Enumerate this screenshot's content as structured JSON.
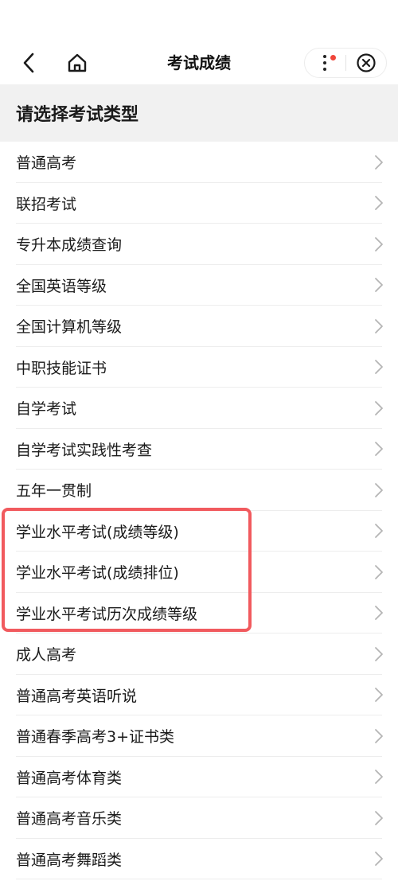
{
  "nav": {
    "title": "考试成绩",
    "icons": {
      "back": "chevron-left-icon",
      "home": "home-icon",
      "more": "more-dots-icon",
      "close": "close-circle-icon"
    },
    "notification_dot_color": "#f0453a"
  },
  "section": {
    "title": "请选择考试类型"
  },
  "list": {
    "items": [
      {
        "label": "普通高考"
      },
      {
        "label": "联招考试"
      },
      {
        "label": "专升本成绩查询"
      },
      {
        "label": "全国英语等级"
      },
      {
        "label": "全国计算机等级"
      },
      {
        "label": "中职技能证书"
      },
      {
        "label": "自学考试"
      },
      {
        "label": "自学考试实践性考查"
      },
      {
        "label": "五年一贯制"
      },
      {
        "label": "学业水平考试(成绩等级)"
      },
      {
        "label": "学业水平考试(成绩排位)"
      },
      {
        "label": "学业水平考试历次成绩等级"
      },
      {
        "label": "成人高考"
      },
      {
        "label": "普通高考英语听说"
      },
      {
        "label": "普通春季高考3+证书类"
      },
      {
        "label": "普通高考体育类"
      },
      {
        "label": "普通高考音乐类"
      },
      {
        "label": "普通高考舞蹈类"
      }
    ],
    "highlight_color": "#f15a5e"
  }
}
